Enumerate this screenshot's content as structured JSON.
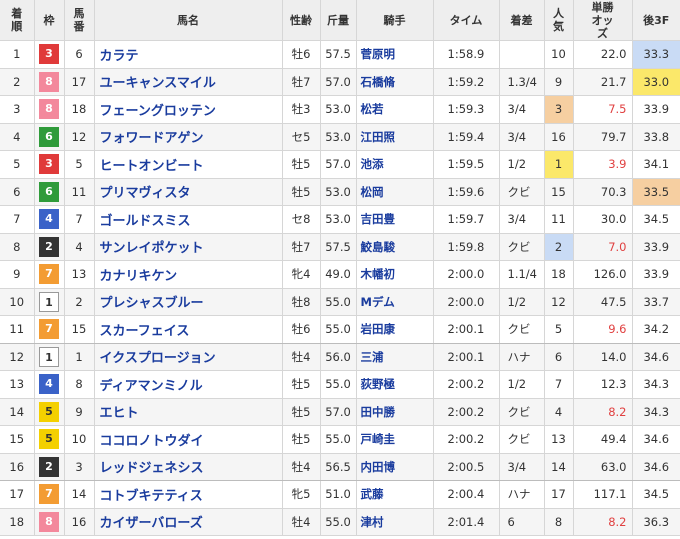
{
  "headers": {
    "pos": "着順",
    "frame": "枠",
    "num": "馬番",
    "horse": "馬名",
    "sexage": "性齢",
    "weight": "斤量",
    "jockey": "騎手",
    "time": "タイム",
    "margin": "着差",
    "pop": "人気",
    "odds": "単勝オッズ",
    "last3f": "後3F"
  },
  "colors": {
    "frame_1": "#ffffff",
    "frame_2": "#333333",
    "frame_3": "#e03a3a",
    "frame_4": "#3a62c8",
    "frame_5": "#f4d000",
    "frame_6": "#2f9b3a",
    "frame_7": "#f39c33",
    "frame_8": "#f3889c",
    "rank1": "#fbe86a",
    "rank2": "#c9dbf5",
    "rank3": "#f6cfa1",
    "odds_red": "#e04040",
    "link": "#1a3c9e"
  },
  "rows": [
    {
      "pos": "1",
      "frame": "3",
      "num": "6",
      "horse": "カラテ",
      "sexage": "牡6",
      "weight": "57.5",
      "jockey": "菅原明",
      "time": "1:58.9",
      "margin": "",
      "pop": "10",
      "odds": "22.0",
      "last3f": "33.3"
    },
    {
      "pos": "2",
      "frame": "8",
      "num": "17",
      "horse": "ユーキャンスマイル",
      "sexage": "牡7",
      "weight": "57.0",
      "jockey": "石橋脩",
      "time": "1:59.2",
      "margin": "1.3/4",
      "pop": "9",
      "odds": "21.7",
      "last3f": "33.0"
    },
    {
      "pos": "3",
      "frame": "8",
      "num": "18",
      "horse": "フェーングロッテン",
      "sexage": "牡3",
      "weight": "53.0",
      "jockey": "松若",
      "time": "1:59.3",
      "margin": "3/4",
      "pop": "3",
      "odds": "7.5",
      "last3f": "33.9"
    },
    {
      "pos": "4",
      "frame": "6",
      "num": "12",
      "horse": "フォワードアゲン",
      "sexage": "セ5",
      "weight": "53.0",
      "jockey": "江田照",
      "time": "1:59.4",
      "margin": "3/4",
      "pop": "16",
      "odds": "79.7",
      "last3f": "33.8"
    },
    {
      "pos": "5",
      "frame": "3",
      "num": "5",
      "horse": "ヒートオンビート",
      "sexage": "牡5",
      "weight": "57.0",
      "jockey": "池添",
      "time": "1:59.5",
      "margin": "1/2",
      "pop": "1",
      "odds": "3.9",
      "last3f": "34.1"
    },
    {
      "pos": "6",
      "frame": "6",
      "num": "11",
      "horse": "プリマヴィスタ",
      "sexage": "牡5",
      "weight": "53.0",
      "jockey": "松岡",
      "time": "1:59.6",
      "margin": "クビ",
      "pop": "15",
      "odds": "70.3",
      "last3f": "33.5"
    },
    {
      "pos": "7",
      "frame": "4",
      "num": "7",
      "horse": "ゴールドスミス",
      "sexage": "セ8",
      "weight": "53.0",
      "jockey": "吉田豊",
      "time": "1:59.7",
      "margin": "3/4",
      "pop": "11",
      "odds": "30.0",
      "last3f": "34.5"
    },
    {
      "pos": "8",
      "frame": "2",
      "num": "4",
      "horse": "サンレイポケット",
      "sexage": "牡7",
      "weight": "57.5",
      "jockey": "鮫島駿",
      "time": "1:59.8",
      "margin": "クビ",
      "pop": "2",
      "odds": "7.0",
      "last3f": "33.9"
    },
    {
      "pos": "9",
      "frame": "7",
      "num": "13",
      "horse": "カナリキケン",
      "sexage": "牝4",
      "weight": "49.0",
      "jockey": "木幡初",
      "time": "2:00.0",
      "margin": "1.1/4",
      "pop": "18",
      "odds": "126.0",
      "last3f": "33.9"
    },
    {
      "pos": "10",
      "frame": "1",
      "num": "2",
      "horse": "プレシャスブルー",
      "sexage": "牡8",
      "weight": "55.0",
      "jockey": "Mデム",
      "time": "2:00.0",
      "margin": "1/2",
      "pop": "12",
      "odds": "47.5",
      "last3f": "33.7"
    },
    {
      "pos": "11",
      "frame": "7",
      "num": "15",
      "horse": "スカーフェイス",
      "sexage": "牡6",
      "weight": "55.0",
      "jockey": "岩田康",
      "time": "2:00.1",
      "margin": "クビ",
      "pop": "5",
      "odds": "9.6",
      "last3f": "34.2"
    },
    {
      "pos": "12",
      "frame": "1",
      "num": "1",
      "horse": "イクスプロージョン",
      "sexage": "牡4",
      "weight": "56.0",
      "jockey": "三浦",
      "time": "2:00.1",
      "margin": "ハナ",
      "pop": "6",
      "odds": "14.0",
      "last3f": "34.6"
    },
    {
      "pos": "13",
      "frame": "4",
      "num": "8",
      "horse": "ディアマンミノル",
      "sexage": "牡5",
      "weight": "55.0",
      "jockey": "荻野極",
      "time": "2:00.2",
      "margin": "1/2",
      "pop": "7",
      "odds": "12.3",
      "last3f": "34.3"
    },
    {
      "pos": "14",
      "frame": "5",
      "num": "9",
      "horse": "エヒト",
      "sexage": "牡5",
      "weight": "57.0",
      "jockey": "田中勝",
      "time": "2:00.2",
      "margin": "クビ",
      "pop": "4",
      "odds": "8.2",
      "last3f": "34.3"
    },
    {
      "pos": "15",
      "frame": "5",
      "num": "10",
      "horse": "ココロノトウダイ",
      "sexage": "牡5",
      "weight": "55.0",
      "jockey": "戸崎圭",
      "time": "2:00.2",
      "margin": "クビ",
      "pop": "13",
      "odds": "49.4",
      "last3f": "34.6"
    },
    {
      "pos": "16",
      "frame": "2",
      "num": "3",
      "horse": "レッドジェネシス",
      "sexage": "牡4",
      "weight": "56.5",
      "jockey": "内田博",
      "time": "2:00.5",
      "margin": "3/4",
      "pop": "14",
      "odds": "63.0",
      "last3f": "34.6"
    },
    {
      "pos": "17",
      "frame": "7",
      "num": "14",
      "horse": "コトブキテティス",
      "sexage": "牝5",
      "weight": "51.0",
      "jockey": "武藤",
      "time": "2:00.4",
      "margin": "ハナ",
      "pop": "17",
      "odds": "117.1",
      "last3f": "34.5"
    },
    {
      "pos": "18",
      "frame": "8",
      "num": "16",
      "horse": "カイザーバローズ",
      "sexage": "牡4",
      "weight": "55.0",
      "jockey": "津村",
      "time": "2:01.4",
      "margin": "6",
      "pop": "8",
      "odds": "8.2",
      "last3f": "36.3"
    }
  ]
}
